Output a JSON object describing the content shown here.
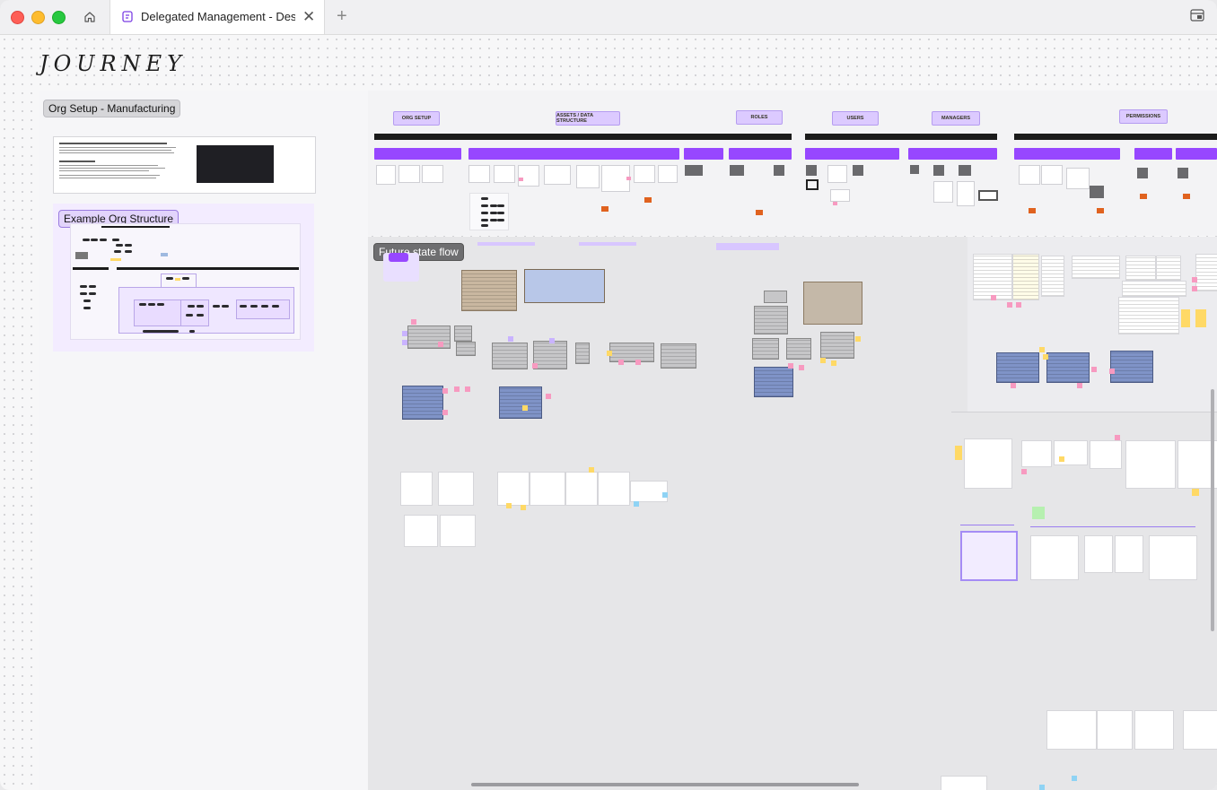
{
  "window": {
    "tab_title": "Delegated Management - Design"
  },
  "board": {
    "journey_title": "JOURNEY",
    "org_setup_label": "Org Setup - Manufacturing",
    "example_org_label": "Example Org Structure",
    "future_state_label": "Future state flow"
  },
  "phases": [
    "ORG SETUP",
    "ASSETS / DATA STRUCTURE",
    "ROLES",
    "USERS",
    "MANAGERS",
    "PERMISSIONS"
  ],
  "colors": {
    "accent_purple": "#9747ff",
    "header_purple": "#dccaff"
  }
}
